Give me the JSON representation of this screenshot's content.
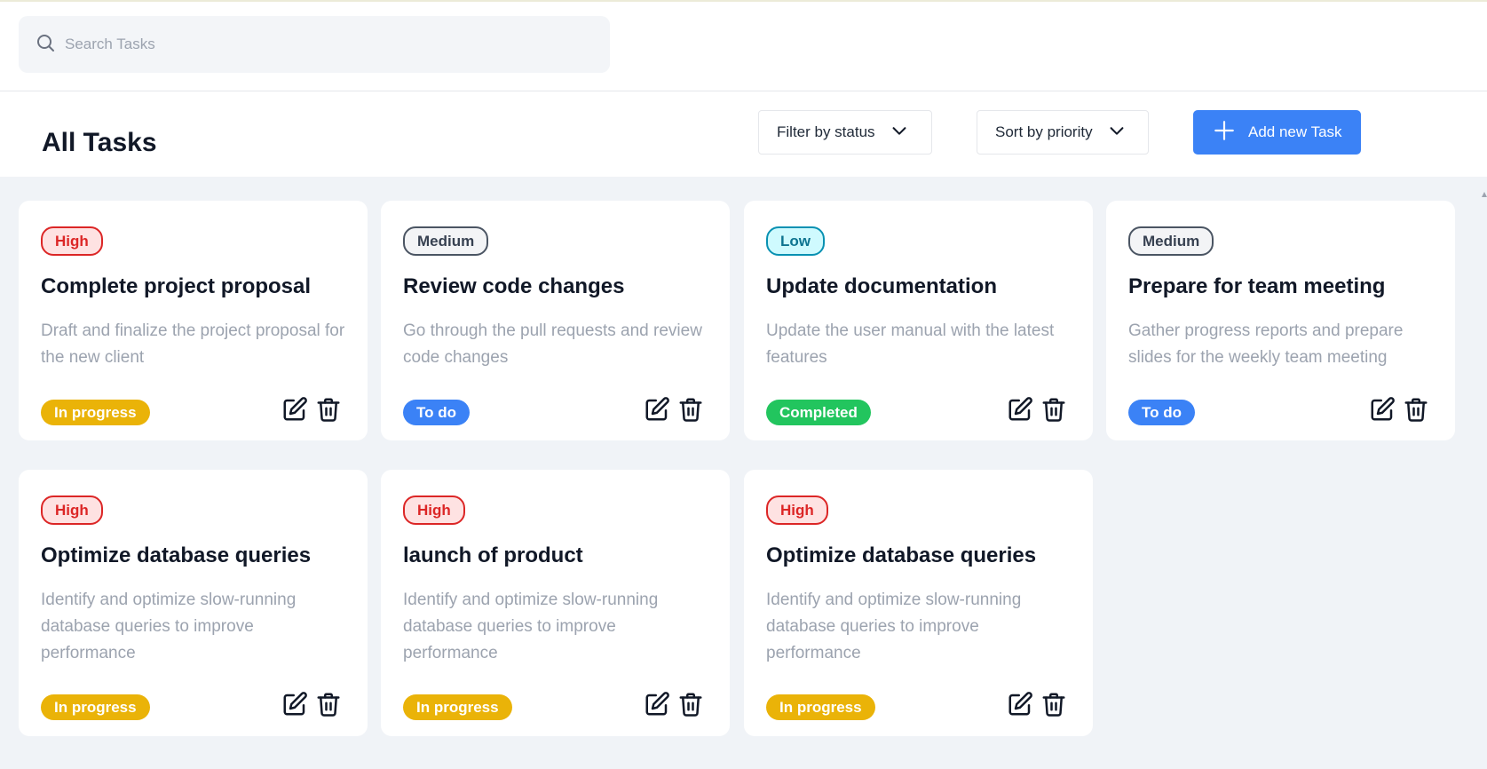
{
  "search": {
    "placeholder": "Search Tasks"
  },
  "header": {
    "title": "All Tasks",
    "filter_label": "Filter by status",
    "sort_label": "Sort by priority",
    "add_label": "Add new Task"
  },
  "colors": {
    "accent": "#3b82f6",
    "high": "#dc2626",
    "low": "#0891b2",
    "in_progress": "#eab308",
    "completed": "#22c55e",
    "background": "#f0f3f7"
  },
  "icons": [
    "search-icon",
    "chevron-down-icon",
    "plus-icon",
    "edit-icon",
    "trash-icon"
  ],
  "tasks": [
    {
      "priority": "High",
      "title": "Complete project proposal",
      "description": "Draft and finalize the project proposal for the new client",
      "status": "In progress"
    },
    {
      "priority": "Medium",
      "title": "Review code changes",
      "description": "Go through the pull requests and review code changes",
      "status": "To do"
    },
    {
      "priority": "Low",
      "title": "Update documentation",
      "description": "Update the user manual with the latest features",
      "status": "Completed"
    },
    {
      "priority": "Medium",
      "title": "Prepare for team meeting",
      "description": "Gather progress reports and prepare slides for the weekly team meeting",
      "status": "To do"
    },
    {
      "priority": "High",
      "title": "Optimize database queries",
      "description": "Identify and optimize slow-running database queries to improve performance",
      "status": "In progress"
    },
    {
      "priority": "High",
      "title": "launch of product",
      "description": "Identify and optimize slow-running database queries to improve performance",
      "status": "In progress"
    },
    {
      "priority": "High",
      "title": "Optimize database queries",
      "description": "Identify and optimize slow-running database queries to improve performance",
      "status": "In progress"
    }
  ]
}
